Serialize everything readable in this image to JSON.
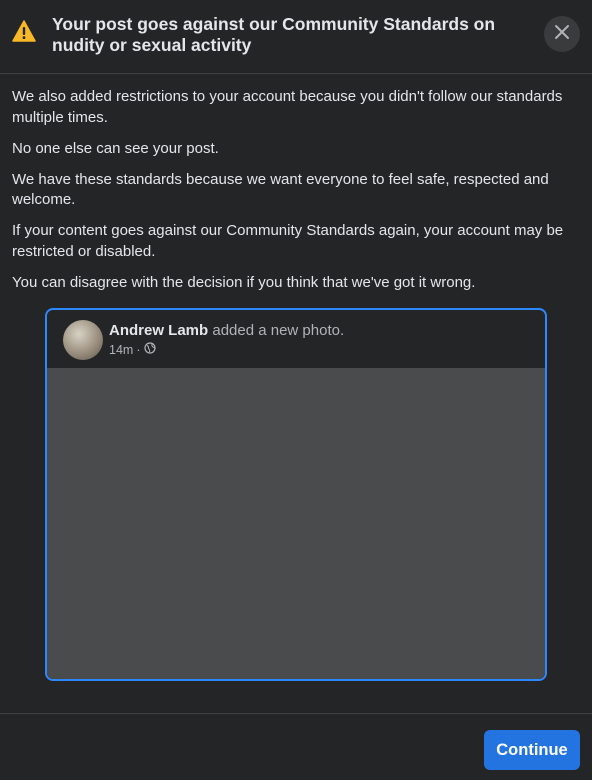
{
  "header": {
    "title": "Your post goes against our Community Standards on nudity or sexual activity",
    "warning_icon": "warning-icon",
    "close_icon": "close-icon"
  },
  "body": {
    "paragraphs": [
      "We also added restrictions to your account because you didn't follow our standards multiple times.",
      "No one else can see your post.",
      "We have these standards because we want everyone to feel safe, respected and welcome.",
      "If your content goes against our Community Standards again, your account may be restricted or disabled.",
      "You can disagree with the decision if you think that we've got it wrong."
    ]
  },
  "post": {
    "author": "Andrew Lamb",
    "action": "added a new photo.",
    "time": "14m",
    "separator": "·",
    "audience_icon": "globe-icon"
  },
  "footer": {
    "continue_label": "Continue"
  },
  "colors": {
    "background": "#242526",
    "accent": "#2374e1",
    "card_border": "#2d88ff",
    "warning": "#f7b928"
  }
}
